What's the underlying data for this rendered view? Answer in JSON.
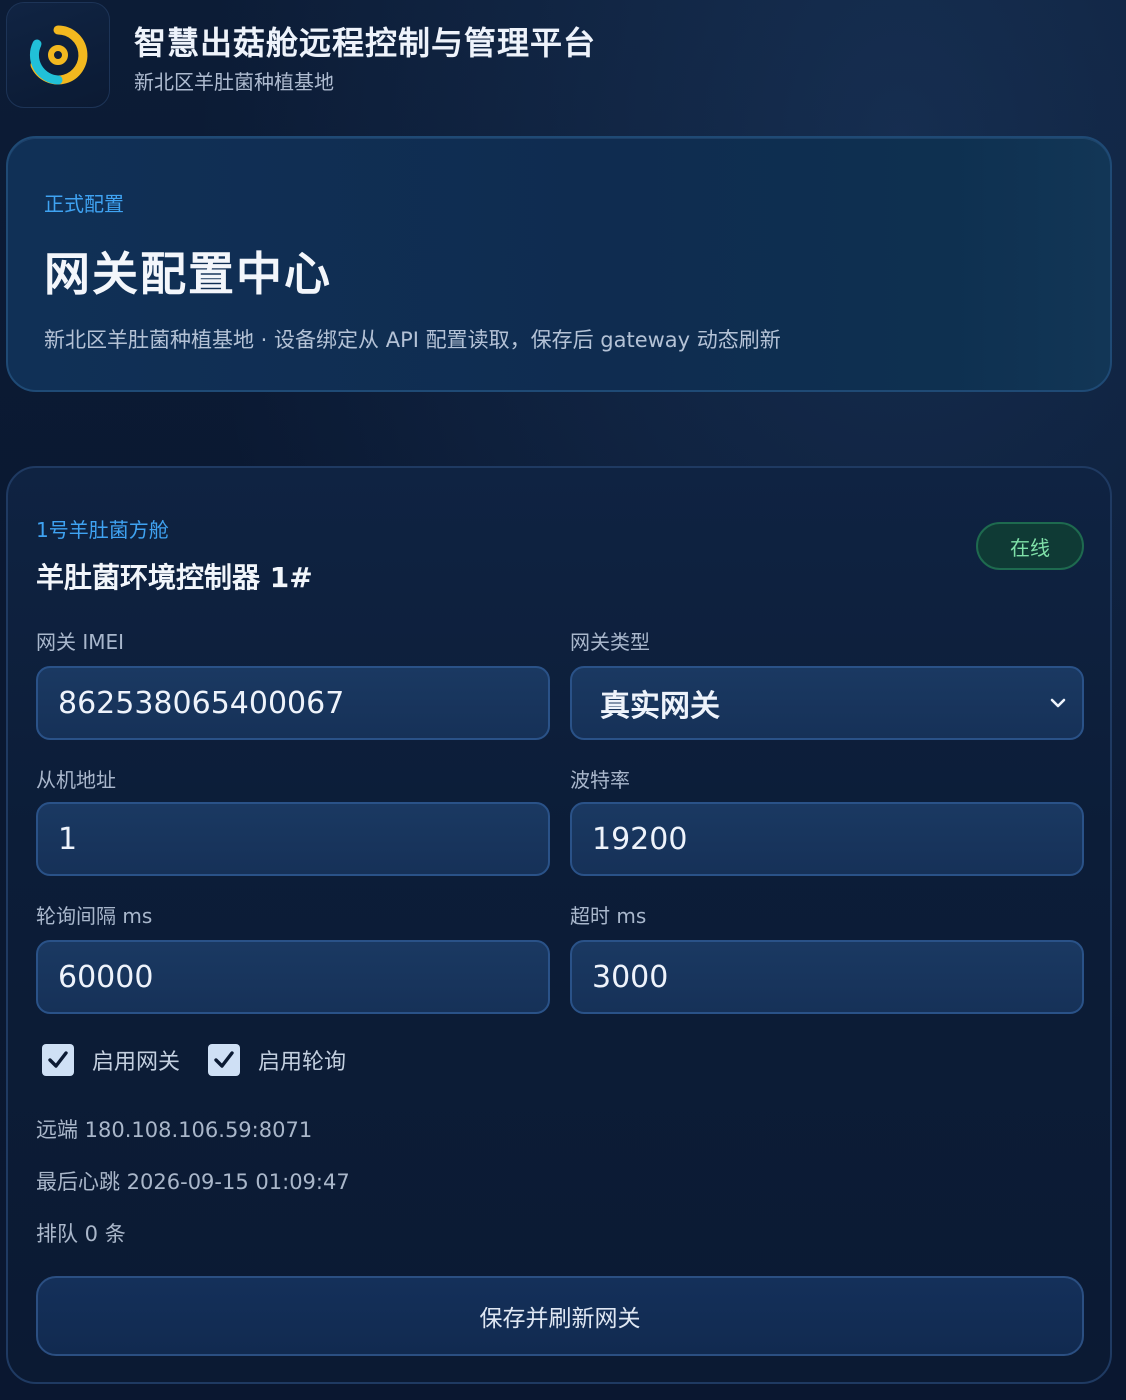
{
  "header": {
    "title": "智慧出菇舱远程控制与管理平台",
    "subtitle": "新北区羊肚菌种植基地",
    "logo_icon": "mushroom-platform-logo-icon"
  },
  "hero": {
    "eyebrow": "正式配置",
    "title": "网关配置中心",
    "description": "新北区羊肚菌种植基地 · 设备绑定从 API 配置读取，保存后 gateway 动态刷新"
  },
  "device": {
    "eyebrow": "1号羊肚菌方舱",
    "title": "羊肚菌环境控制器 1#",
    "status": "在线",
    "fields": {
      "imei": {
        "label": "网关 IMEI",
        "value": "862538065400067"
      },
      "type": {
        "label": "网关类型",
        "value": "真实网关"
      },
      "slave": {
        "label": "从机地址",
        "value": "1"
      },
      "baud": {
        "label": "波特率",
        "value": "19200"
      },
      "poll": {
        "label": "轮询间隔 ms",
        "value": "60000"
      },
      "timeout": {
        "label": "超时 ms",
        "value": "3000"
      }
    },
    "checkboxes": {
      "enable_gateway": "启用网关",
      "enable_polling": "启用轮询"
    },
    "info": {
      "remote": "远端 180.108.106.59:8071",
      "heartbeat": "最后心跳 2026-09-15 01:09:47",
      "queue": "排队 0 条"
    },
    "save_label": "保存并刷新网关"
  },
  "colors": {
    "accent": "#3fa3f2",
    "online": "#7fe0a8",
    "background": "#0a1730"
  }
}
